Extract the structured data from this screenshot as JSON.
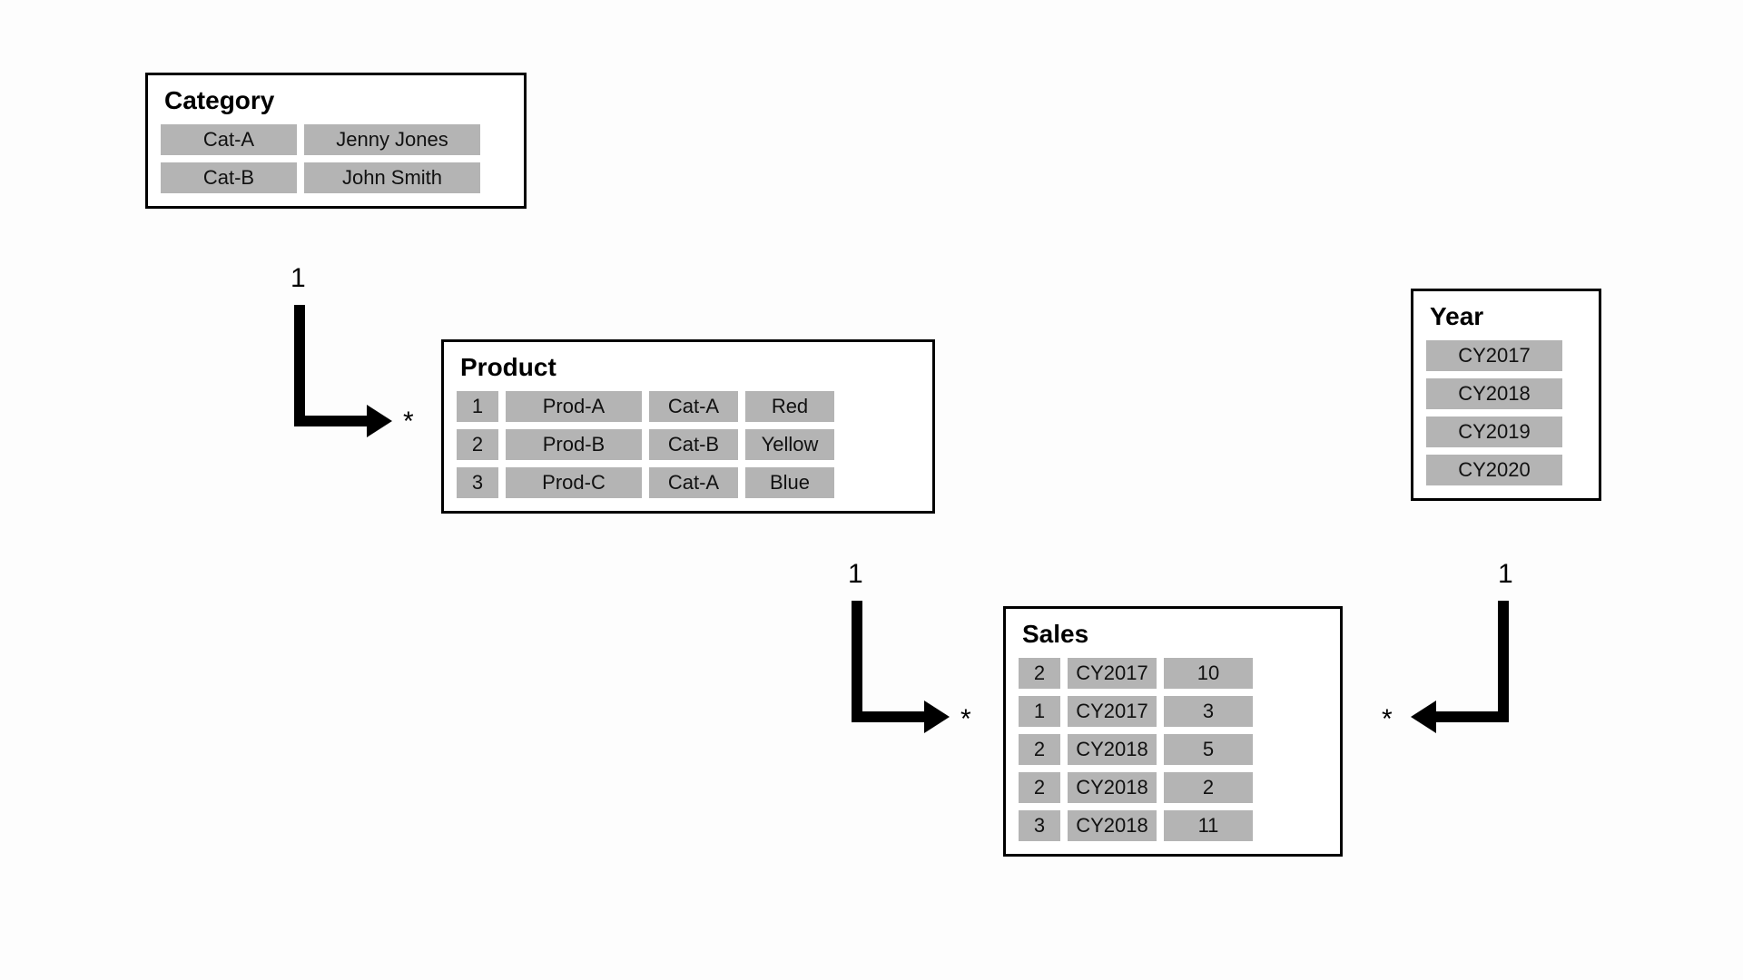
{
  "entities": {
    "category": {
      "title": "Category",
      "rows": [
        [
          "Cat-A",
          "Jenny Jones"
        ],
        [
          "Cat-B",
          "John Smith"
        ]
      ]
    },
    "product": {
      "title": "Product",
      "rows": [
        [
          "1",
          "Prod-A",
          "Cat-A",
          "Red"
        ],
        [
          "2",
          "Prod-B",
          "Cat-B",
          "Yellow"
        ],
        [
          "3",
          "Prod-C",
          "Cat-A",
          "Blue"
        ]
      ]
    },
    "sales": {
      "title": "Sales",
      "rows": [
        [
          "2",
          "CY2017",
          "10"
        ],
        [
          "1",
          "CY2017",
          "3"
        ],
        [
          "2",
          "CY2018",
          "5"
        ],
        [
          "2",
          "CY2018",
          "2"
        ],
        [
          "3",
          "CY2018",
          "11"
        ]
      ]
    },
    "year": {
      "title": "Year",
      "rows": [
        [
          "CY2017"
        ],
        [
          "CY2018"
        ],
        [
          "CY2019"
        ],
        [
          "CY2020"
        ]
      ]
    }
  },
  "cardinalities": {
    "cat_prod_one": "1",
    "cat_prod_many": "*",
    "prod_sales_one": "1",
    "prod_sales_many": "*",
    "year_sales_one": "1",
    "year_sales_many": "*"
  }
}
